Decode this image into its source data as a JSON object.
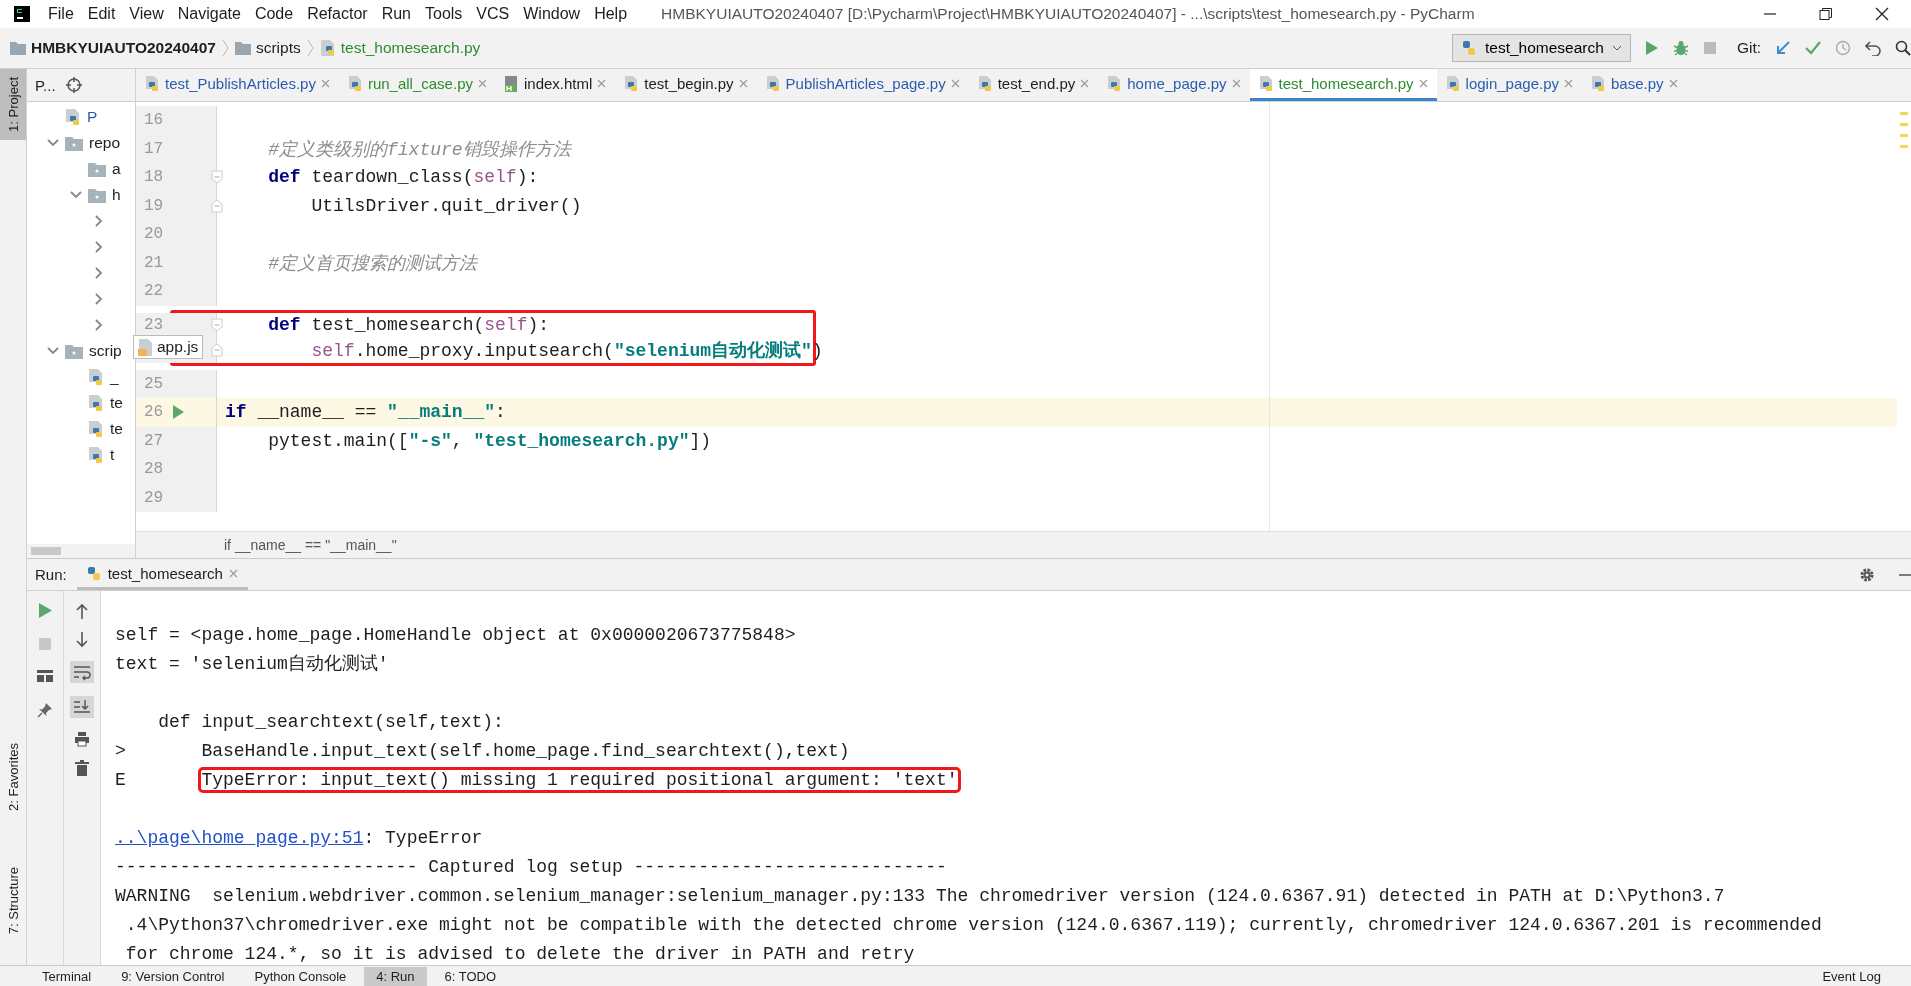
{
  "menu_bar": {
    "items": [
      "File",
      "Edit",
      "View",
      "Navigate",
      "Code",
      "Refactor",
      "Run",
      "Tools",
      "VCS",
      "Window",
      "Help"
    ],
    "title": "HMBKYUIAUTO20240407 [D:\\Pycharm\\Project\\HMBKYUIAUTO20240407] - ...\\scripts\\test_homesearch.py - PyCharm"
  },
  "nav_bar": {
    "breadcrumbs": [
      {
        "label": "HMBKYUIAUTO20240407",
        "kind": "project"
      },
      {
        "label": "scripts",
        "kind": "folder"
      },
      {
        "label": "test_homesearch.py",
        "kind": "file"
      }
    ],
    "run_config": "test_homesearch",
    "git_label": "Git:"
  },
  "tool_strip": [
    {
      "label": "1: Project",
      "selected": true,
      "kind": "project"
    },
    {
      "label": "2: Favorites",
      "selected": false,
      "kind": "favorites"
    },
    {
      "label": "7: Structure",
      "selected": false,
      "kind": "structure"
    }
  ],
  "project_panel": {
    "title": "P...",
    "tooltip": "app.js",
    "tree": [
      {
        "label": "P",
        "kind": "py"
      },
      {
        "label": "repo",
        "kind": "folder",
        "expanded": true,
        "children": [
          {
            "label": "a",
            "kind": "folder"
          },
          {
            "label": "h",
            "kind": "folder",
            "expanded": true,
            "children": [
              {
                "expanded": false
              },
              {
                "expanded": false
              },
              {
                "expanded": false
              },
              {
                "expanded": false
              },
              {
                "expanded": false
              }
            ]
          }
        ]
      },
      {
        "label": "scrip",
        "kind": "folder",
        "expanded": true,
        "children": [
          {
            "label": "_",
            "kind": "py"
          },
          {
            "label": "te",
            "kind": "py"
          },
          {
            "label": "te",
            "kind": "py"
          },
          {
            "label": "t",
            "kind": "py"
          }
        ]
      }
    ]
  },
  "editor_tabs": [
    {
      "label": "test_PublishArticles.py",
      "kind": "py",
      "selected": false,
      "color": "#2a5db0"
    },
    {
      "label": "run_all_case.py",
      "kind": "py",
      "selected": false,
      "color": "#2f8b2f"
    },
    {
      "label": "index.html",
      "kind": "html",
      "selected": false,
      "color": "#1e1e1e"
    },
    {
      "label": "test_begin.py",
      "kind": "py",
      "selected": false,
      "color": "#1e1e1e"
    },
    {
      "label": "PublishArticles_page.py",
      "kind": "py",
      "selected": false,
      "color": "#2a5db0"
    },
    {
      "label": "test_end.py",
      "kind": "py",
      "selected": false,
      "color": "#1e1e1e"
    },
    {
      "label": "home_page.py",
      "kind": "py",
      "selected": false,
      "color": "#2a5db0"
    },
    {
      "label": "test_homesearch.py",
      "kind": "py",
      "selected": true,
      "color": "#2f8b2f"
    },
    {
      "label": "login_page.py",
      "kind": "py",
      "selected": false,
      "color": "#2a5db0"
    },
    {
      "label": "base.py",
      "kind": "py",
      "selected": false,
      "color": "#2a5db0"
    }
  ],
  "editor": {
    "lines": [
      {
        "number": "16"
      },
      {
        "number": "17",
        "tokens": [
          {
            "kind": "comment",
            "text": "    #定义类级别的fixture销毁操作方法"
          }
        ]
      },
      {
        "number": "18",
        "fold_start": true,
        "tokens": [
          {
            "kind": "keyword",
            "text": "    def"
          },
          {
            "kind": "plain",
            "text": " teardown_class("
          },
          {
            "kind": "self",
            "text": "self"
          },
          {
            "kind": "plain",
            "text": "):"
          }
        ]
      },
      {
        "number": "19",
        "fold_end": true,
        "tokens": [
          {
            "kind": "plain",
            "text": "        UtilsDriver.quit_driver()"
          }
        ]
      },
      {
        "number": "20"
      },
      {
        "number": "21",
        "tokens": [
          {
            "kind": "comment",
            "text": "    #定义首页搜索的测试方法"
          }
        ]
      },
      {
        "number": "22"
      },
      {
        "number": "23",
        "fold_start": true,
        "boxed": true,
        "tokens": [
          {
            "kind": "keyword",
            "text": "    def"
          },
          {
            "kind": "plain",
            "text": " test_homesearch("
          },
          {
            "kind": "self",
            "text": "self"
          },
          {
            "kind": "plain",
            "text": "):"
          }
        ]
      },
      {
        "fold_end": true,
        "boxed": true,
        "tokens": [
          {
            "kind": "self",
            "text": "        self"
          },
          {
            "kind": "plain",
            "text": ".home_proxy.inputsearch("
          },
          {
            "kind": "string",
            "text": "\"selenium自动化测试\""
          },
          {
            "kind": "plain",
            "text": ")"
          }
        ]
      },
      {
        "number": "25"
      },
      {
        "number": "26",
        "current": true,
        "run_marker": true,
        "tokens": [
          {
            "kind": "keyword",
            "text": "if"
          },
          {
            "kind": "plain",
            "text": " __name__ == "
          },
          {
            "kind": "string",
            "text": "\"__main__\""
          },
          {
            "kind": "plain",
            "text": ":"
          }
        ]
      },
      {
        "number": "27",
        "tokens": [
          {
            "kind": "plain",
            "text": "    pytest.main(["
          },
          {
            "kind": "string",
            "text": "\"-s\""
          },
          {
            "kind": "plain",
            "text": ", "
          },
          {
            "kind": "string",
            "text": "\"test_homesearch.py\""
          },
          {
            "kind": "plain",
            "text": "])"
          }
        ]
      },
      {
        "number": "28"
      },
      {
        "number": "29"
      }
    ],
    "breadcrumb": "if __name__ == \"__main__\""
  },
  "run_panel": {
    "label": "Run:",
    "tab": "test_homesearch",
    "console": [
      {
        "kind": "text",
        "text": "self = <page.home_page.HomeHandle object at 0x0000020673775848>"
      },
      {
        "kind": "text",
        "text": "text = 'selenium自动化测试'"
      },
      {
        "kind": "blank"
      },
      {
        "kind": "text",
        "text": "    def input_searchtext(self,text):"
      },
      {
        "kind": "text",
        "marker": ">",
        "text": "BaseHandle.input_text(self.home_page.find_searchtext(),text)"
      },
      {
        "kind": "text",
        "marker": "E",
        "boxed": true,
        "text": "TypeError: input_text() missing 1 required positional argument: 'text'"
      },
      {
        "kind": "blank"
      },
      {
        "kind": "link",
        "link": "..\\page\\home_page.py:51",
        "text": ": TypeError"
      },
      {
        "kind": "text",
        "text": "---------------------------- Captured log setup -----------------------------"
      },
      {
        "kind": "text",
        "text": "WARNING  selenium.webdriver.common.selenium_manager:selenium_manager.py:133 The chromedriver version (124.0.6367.91) detected in PATH at D:\\Python3.7"
      },
      {
        "kind": "text",
        "text": " .4\\Python37\\chromedriver.exe might not be compatible with the detected chrome version (124.0.6367.119); currently, chromedriver 124.0.6367.201 is recommended"
      },
      {
        "kind": "text",
        "text": " for chrome 124.*, so it is advised to delete the driver in PATH and retry"
      }
    ]
  },
  "bottom_bar": {
    "tabs": [
      {
        "label": "Terminal",
        "selected": false
      },
      {
        "label": "9: Version Control",
        "selected": false
      },
      {
        "label": "Python Console",
        "selected": false
      },
      {
        "label": "4: Run",
        "selected": true
      },
      {
        "label": "6: TODO",
        "selected": false
      }
    ],
    "event_log": "Event Log"
  }
}
